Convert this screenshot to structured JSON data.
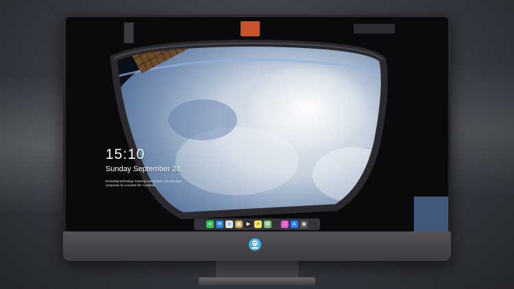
{
  "lockscreen": {
    "time": "15:10",
    "date": "Sunday September 28",
    "tagline": "Innovating technology. Ensuring sound future. Be your ideal companion for a smarter life. Acradrain"
  },
  "dock": {
    "items": [
      {
        "name": "messages-icon",
        "color": "#34c759"
      },
      {
        "name": "mail-icon",
        "color": "#1e88e5"
      },
      {
        "name": "safari-icon",
        "color": "#e8e8e8"
      },
      {
        "name": "preview-icon",
        "color": "#c6a15b"
      },
      {
        "name": "final-cut-icon",
        "color": "#2c2c2c"
      },
      {
        "name": "notes-icon",
        "color": "#f5e36a"
      },
      {
        "name": "photos-icon",
        "color": "#7cc576"
      },
      {
        "name": "itunes-icon",
        "color": "#e45ac8"
      },
      {
        "name": "app-store-icon",
        "color": "#2f7ef5"
      },
      {
        "name": "camera-icon",
        "color": "#5a5a5f"
      }
    ]
  },
  "colors": {
    "accent_logo": "#3fb4e8"
  }
}
